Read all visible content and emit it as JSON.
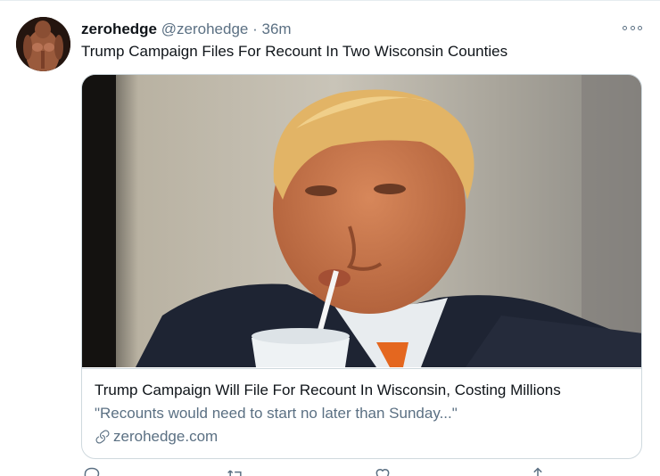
{
  "tweet": {
    "display_name": "zerohedge",
    "handle": "@zerohedge",
    "separator": "·",
    "time": "36m",
    "text": "Trump Campaign Files For Recount In Two Wisconsin Counties"
  },
  "card": {
    "title": "Trump Campaign Will File For Recount In Wisconsin, Costing Millions",
    "description": "\"Recounts would need to start no later than Sunday...\"",
    "domain": "zerohedge.com"
  },
  "icons": {
    "more": "more-horizontal-icon",
    "link": "link-icon",
    "reply": "reply-icon",
    "retweet": "retweet-icon",
    "like": "heart-icon",
    "share": "share-icon"
  },
  "colors": {
    "primary_text": "#0f1419",
    "secondary_text": "#5b7083",
    "border": "#cfd9de"
  }
}
